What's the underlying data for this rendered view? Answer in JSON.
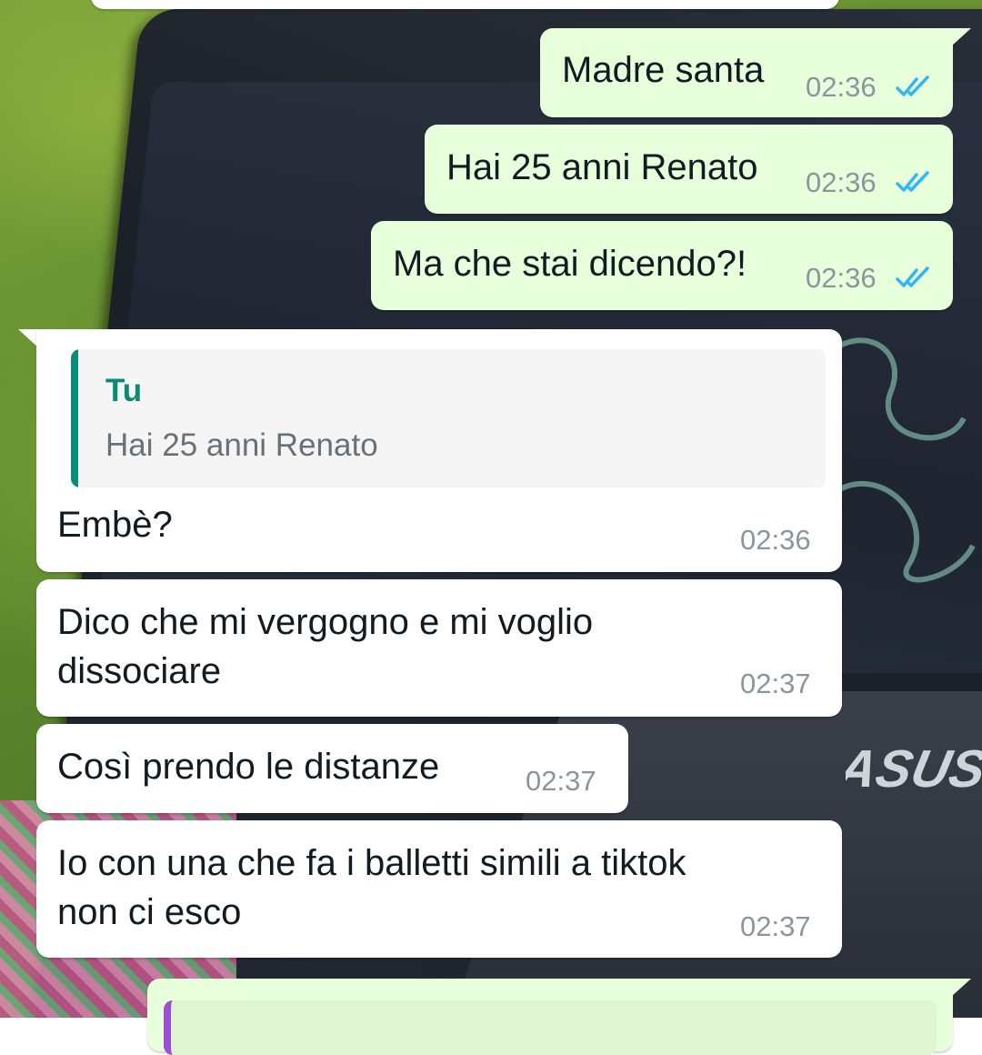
{
  "chat": {
    "outgoing": [
      {
        "text": "Madre santa",
        "time": "02:36"
      },
      {
        "text": "Hai 25 anni Renato",
        "time": "02:36"
      },
      {
        "text": "Ma che stai dicendo?!",
        "time": "02:36"
      }
    ],
    "reply": {
      "quote_author": "Tu",
      "quote_text": "Hai 25 anni Renato",
      "text": "Embè?",
      "time": "02:36"
    },
    "incoming": [
      {
        "line1": "Dico che mi vergogno e mi voglio",
        "line2": "dissociare",
        "time": "02:37"
      },
      {
        "text": "Così prendo le distanze",
        "time": "02:37"
      },
      {
        "line1": "Io con una che fa i balletti simili a tiktok",
        "line2": "non ci esco",
        "time": "02:37"
      }
    ]
  },
  "wallpaper": {
    "brand_logo": "ASUS"
  },
  "colors": {
    "outgoing_bubble": "#e7ffdb",
    "incoming_bubble": "#ffffff",
    "read_tick": "#34b7f1",
    "quote_accent": "#0b8a76",
    "timestamp": "#8b959c"
  },
  "icons": {
    "read_receipt": "double-check-icon"
  }
}
